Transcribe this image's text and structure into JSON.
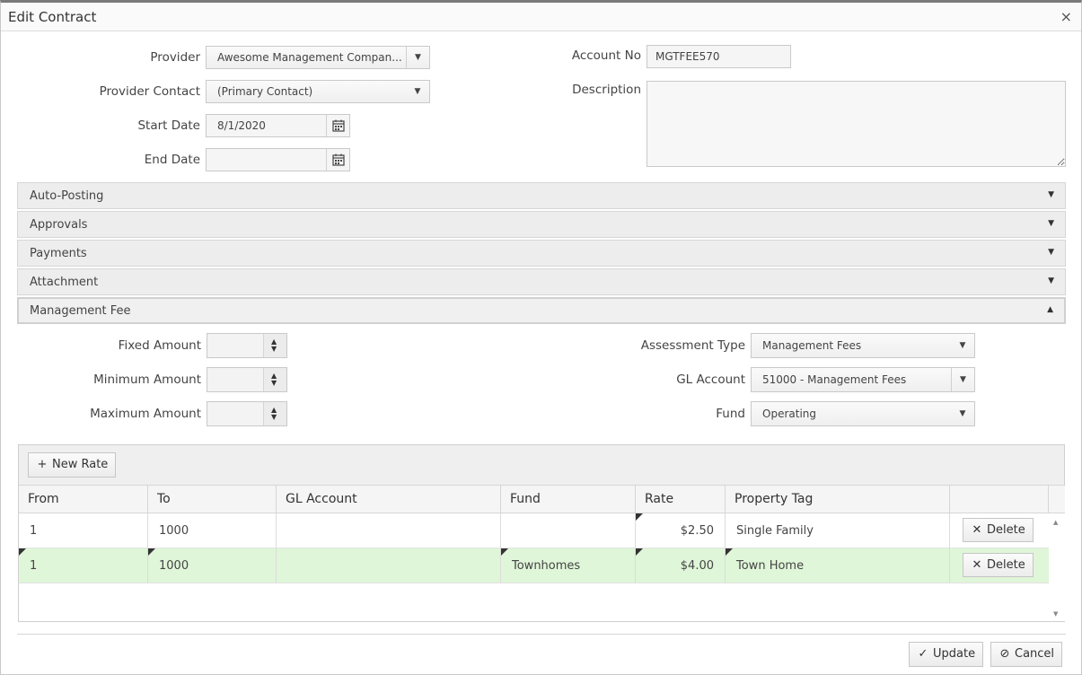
{
  "window": {
    "title": "Edit Contract",
    "close": "×"
  },
  "form": {
    "provider_label": "Provider",
    "provider_value": "Awesome Management Compan...",
    "provider_contact_label": "Provider Contact",
    "provider_contact_value": "(Primary Contact)",
    "start_date_label": "Start Date",
    "start_date_value": "8/1/2020",
    "end_date_label": "End Date",
    "end_date_value": "",
    "account_no_label": "Account No",
    "account_no_value": "MGTFEE570",
    "description_label": "Description",
    "description_value": ""
  },
  "panels": [
    {
      "title": "Auto-Posting",
      "expanded": false
    },
    {
      "title": "Approvals",
      "expanded": false
    },
    {
      "title": "Payments",
      "expanded": false
    },
    {
      "title": "Attachment",
      "expanded": false
    },
    {
      "title": "Management Fee",
      "expanded": true
    }
  ],
  "fee": {
    "fixed_label": "Fixed Amount",
    "minimum_label": "Minimum Amount",
    "maximum_label": "Maximum Amount",
    "assessment_type_label": "Assessment Type",
    "assessment_type_value": "Management Fees",
    "gl_account_label": "GL Account",
    "gl_account_value": "51000 - Management Fees",
    "fund_label": "Fund",
    "fund_value": "Operating"
  },
  "grid": {
    "new_rate_label": "New Rate",
    "columns": [
      "From",
      "To",
      "GL Account",
      "Fund",
      "Rate",
      "Property Tag"
    ],
    "rows": [
      {
        "from": "1",
        "to": "1000",
        "gl_account": "",
        "fund": "",
        "rate": "$2.50",
        "property_tag": "Single Family",
        "delete": "Delete"
      },
      {
        "from": "1",
        "to": "1000",
        "gl_account": "",
        "fund": "Townhomes",
        "rate": "$4.00",
        "property_tag": "Town Home",
        "delete": "Delete"
      }
    ]
  },
  "footer": {
    "update_label": "Update",
    "cancel_label": "Cancel"
  },
  "colors": {
    "selected_row": "#dff6d8",
    "panel_bg": "#ededed"
  }
}
